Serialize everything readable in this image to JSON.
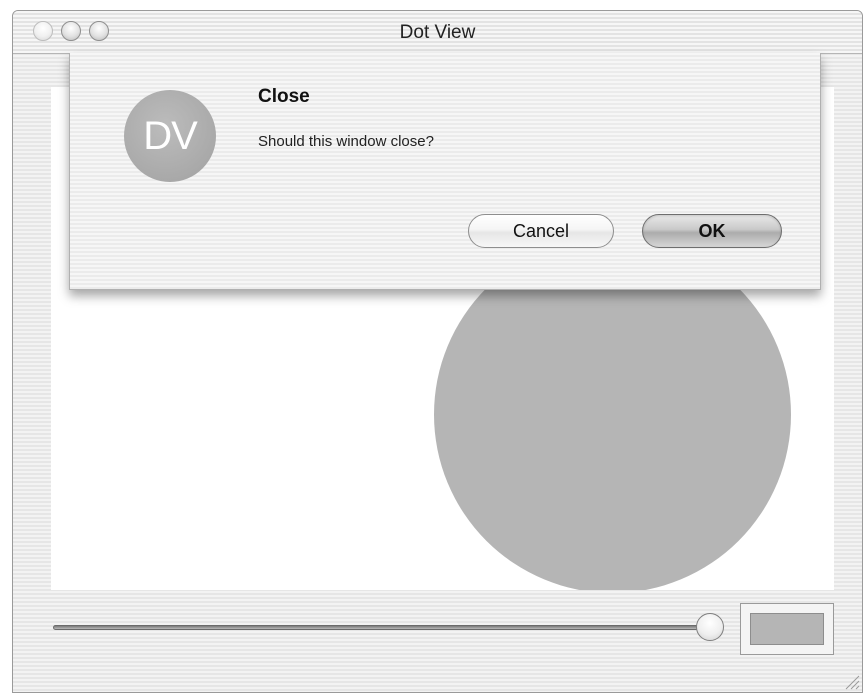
{
  "window": {
    "title": "Dot View"
  },
  "sheet": {
    "icon_text": "DV",
    "title": "Close",
    "message": "Should this window close?",
    "cancel_label": "Cancel",
    "ok_label": "OK"
  },
  "controls": {
    "slider_value_fraction": 1.0,
    "color_well_color": "#b5b5b5"
  },
  "dot": {
    "color": "#b5b5b5"
  },
  "icons": {
    "close": "close-icon",
    "minimize": "minimize-icon",
    "zoom": "zoom-icon",
    "resize": "resize-grip-icon"
  }
}
